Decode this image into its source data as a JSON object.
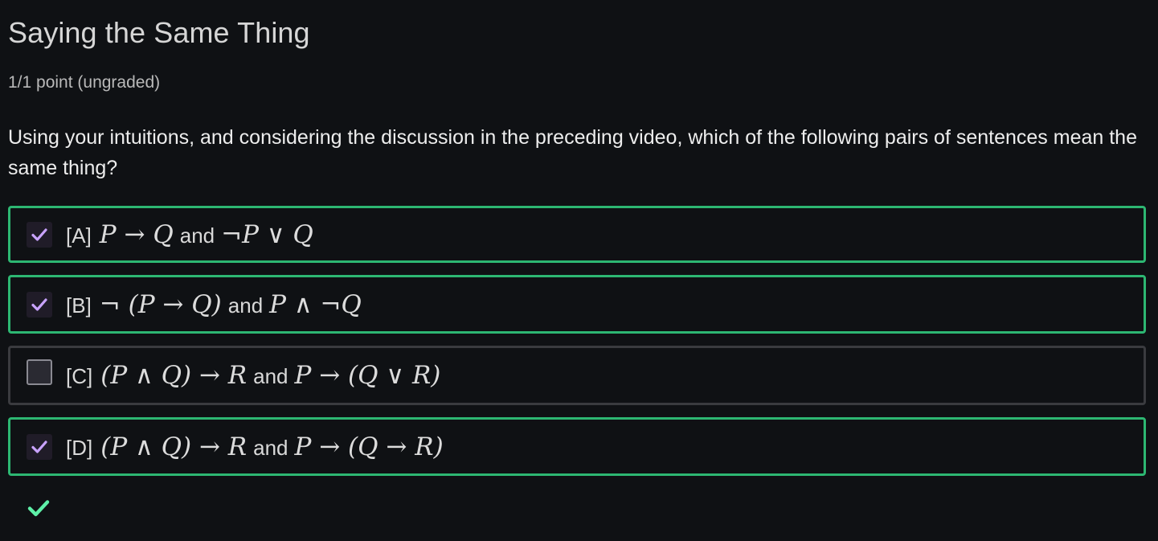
{
  "page": {
    "title": "Saying the Same Thing",
    "points": "1/1 point (ungraded)",
    "question": "Using your intuitions, and considering the discussion in the preceding video, which of the following pairs of sentences mean the same thing?"
  },
  "options": [
    {
      "key": "[A]",
      "left": "P → Q",
      "conj": "and",
      "right": "¬P ∨ Q",
      "checked": true
    },
    {
      "key": "[B]",
      "left": "¬ (P → Q)",
      "conj": "and",
      "right": "P ∧ ¬Q",
      "checked": true
    },
    {
      "key": "[C]",
      "left": "(P ∧ Q) → R",
      "conj": "and",
      "right": "P → (Q ∨ R)",
      "checked": false
    },
    {
      "key": "[D]",
      "left": "(P ∧ Q) → R",
      "conj": "and",
      "right": "P → (Q → R)",
      "checked": true
    }
  ],
  "colors": {
    "correct_border": "#2db772",
    "unchecked_border": "#3a3b3f",
    "checkmark": "#c9a3ff",
    "result_check": "#5ef0a8",
    "background": "#0f1114"
  },
  "icons": {
    "checkbox_checked": "check-icon",
    "result": "correct-check-icon"
  }
}
